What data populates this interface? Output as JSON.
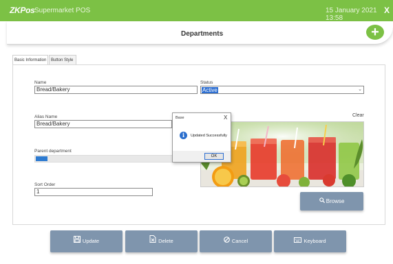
{
  "window": {
    "logo": "ZKPos",
    "app_title": "Supermarket POS",
    "datetime": "15 January 2021 13:58",
    "close_label": "X"
  },
  "header": {
    "title": "Departments",
    "add_label": "+"
  },
  "tabs": [
    {
      "label": "Basic Information",
      "active": true
    },
    {
      "label": "Button Style",
      "active": false
    }
  ],
  "form": {
    "name_label": "Name",
    "name_value": "Bread/Bakery",
    "status_label": "Status",
    "status_value": "Active",
    "alias_label": "Alias Name",
    "alias_value": "Bread/Bakery",
    "parent_label": "Parent department",
    "sort_label": "Sort Order",
    "sort_value": "1",
    "clear_label": "Clear",
    "browse_label": "Browse"
  },
  "buttons": {
    "update": "Update",
    "delete": "Delete",
    "cancel": "Cancel",
    "keyboard": "Keyboard"
  },
  "dialog": {
    "title": "Base",
    "close_label": "X",
    "message": "Updated Successfully",
    "ok_label": "OK"
  },
  "colors": {
    "brand_green": "#7cc145",
    "button_blue_grey": "#7f95ad",
    "selection_blue": "#2e6fd1"
  }
}
